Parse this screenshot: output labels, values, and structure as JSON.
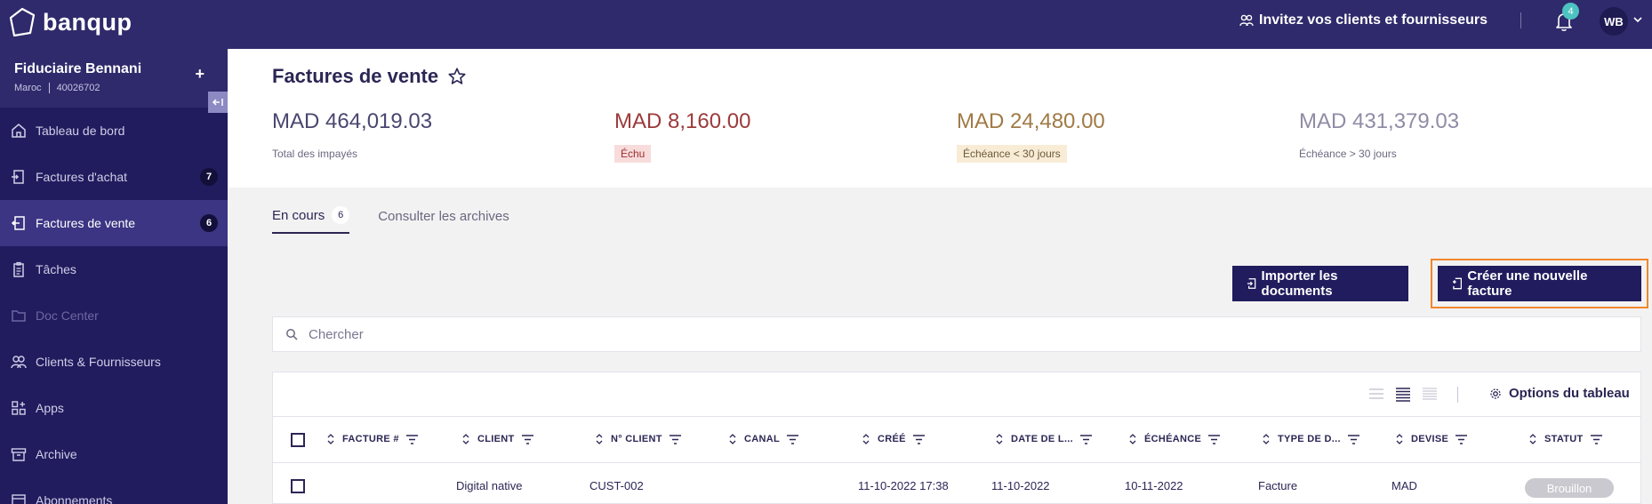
{
  "app": {
    "brand": "banqup"
  },
  "topbar": {
    "invite_label": "Invitez vos clients et fournisseurs",
    "notification_count": "4",
    "avatar_initials": "WB"
  },
  "org": {
    "name": "Fiduciaire Bennani",
    "country": "Maroc",
    "id": "40026702"
  },
  "sidebar": {
    "items": [
      {
        "label": "Tableau de bord",
        "icon": "home-icon"
      },
      {
        "label": "Factures d'achat",
        "icon": "inbox-in-icon",
        "count": "7"
      },
      {
        "label": "Factures de vente",
        "icon": "outbox-icon",
        "count": "6",
        "active": true
      },
      {
        "label": "Tâches",
        "icon": "clipboard-icon"
      },
      {
        "label": "Doc Center",
        "icon": "folder-icon",
        "disabled": true
      },
      {
        "label": "Clients & Fournisseurs",
        "icon": "people-icon"
      },
      {
        "label": "Apps",
        "icon": "apps-icon"
      },
      {
        "label": "Archive",
        "icon": "archive-icon"
      },
      {
        "label": "Abonnements",
        "icon": "subscription-icon"
      }
    ]
  },
  "page": {
    "title": "Factures de vente"
  },
  "stats": [
    {
      "value": "MAD 464,019.03",
      "label": "Total des impayés"
    },
    {
      "value": "MAD 8,160.00",
      "label": "Échu",
      "color": "#9c3a3a"
    },
    {
      "value": "MAD 24,480.00",
      "label": "Échéance < 30 jours",
      "color": "#a07a45"
    },
    {
      "value": "MAD 431,379.03",
      "label": "Échéance > 30 jours",
      "color": "#8f8ca6"
    }
  ],
  "tabs": [
    {
      "label": "En cours",
      "count": "6",
      "active": true
    },
    {
      "label": "Consulter les archives"
    }
  ],
  "actions": {
    "import_label": "Importer les documents",
    "create_label": "Créer une nouvelle facture"
  },
  "search": {
    "placeholder": "Chercher"
  },
  "table": {
    "options_label": "Options du tableau",
    "columns": [
      "FACTURE #",
      "CLIENT",
      "N° CLIENT",
      "CANAL",
      "CRÉÉ",
      "DATE DE L...",
      "ÉCHÉANCE",
      "TYPE DE D...",
      "DEVISE",
      "STATUT"
    ],
    "rows": [
      {
        "invoice": "",
        "client": "Digital native",
        "client_no": "CUST-002",
        "channel": "",
        "created": "11-10-2022 17:38",
        "date": "11-10-2022",
        "due": "10-11-2022",
        "doc_type": "Facture",
        "currency": "MAD",
        "status": "Brouillon"
      }
    ]
  },
  "colors": {
    "topbar": "#2f2a6b",
    "sidebar": "#211c5e",
    "accent": "#211c5e",
    "highlight": "#f2862b"
  }
}
